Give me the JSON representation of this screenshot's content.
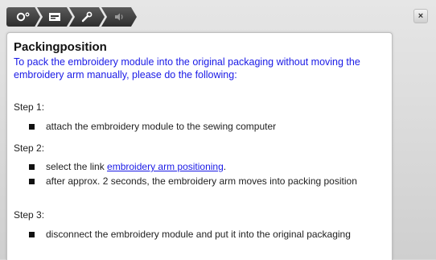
{
  "toolbar": {
    "tabs": [
      {
        "icon": "settings-icon"
      },
      {
        "icon": "machine-icon"
      },
      {
        "icon": "wrench-icon"
      },
      {
        "icon": "speaker-icon"
      }
    ],
    "close_label": "×"
  },
  "content": {
    "title": "Packingposition",
    "intro": "To pack the embroidery module into the original packaging without moving the embroidery arm manually, please do the following:",
    "steps": [
      {
        "label": "Step 1:",
        "items": [
          {
            "text": "attach the embroidery module to the sewing computer"
          }
        ]
      },
      {
        "label": "Step 2:",
        "items": [
          {
            "prefix": "select the link ",
            "link": "embroidery arm positioning",
            "suffix": "."
          },
          {
            "text": "after approx. 2 seconds, the embroidery arm moves into packing position"
          }
        ]
      },
      {
        "label": "Step 3:",
        "items": [
          {
            "text": "disconnect the embroidery module and put it into the original packaging"
          }
        ]
      }
    ]
  },
  "colors": {
    "link": "#1a1ae6",
    "intro": "#1a1ae6",
    "tab_bg": "#3a3a3a"
  }
}
